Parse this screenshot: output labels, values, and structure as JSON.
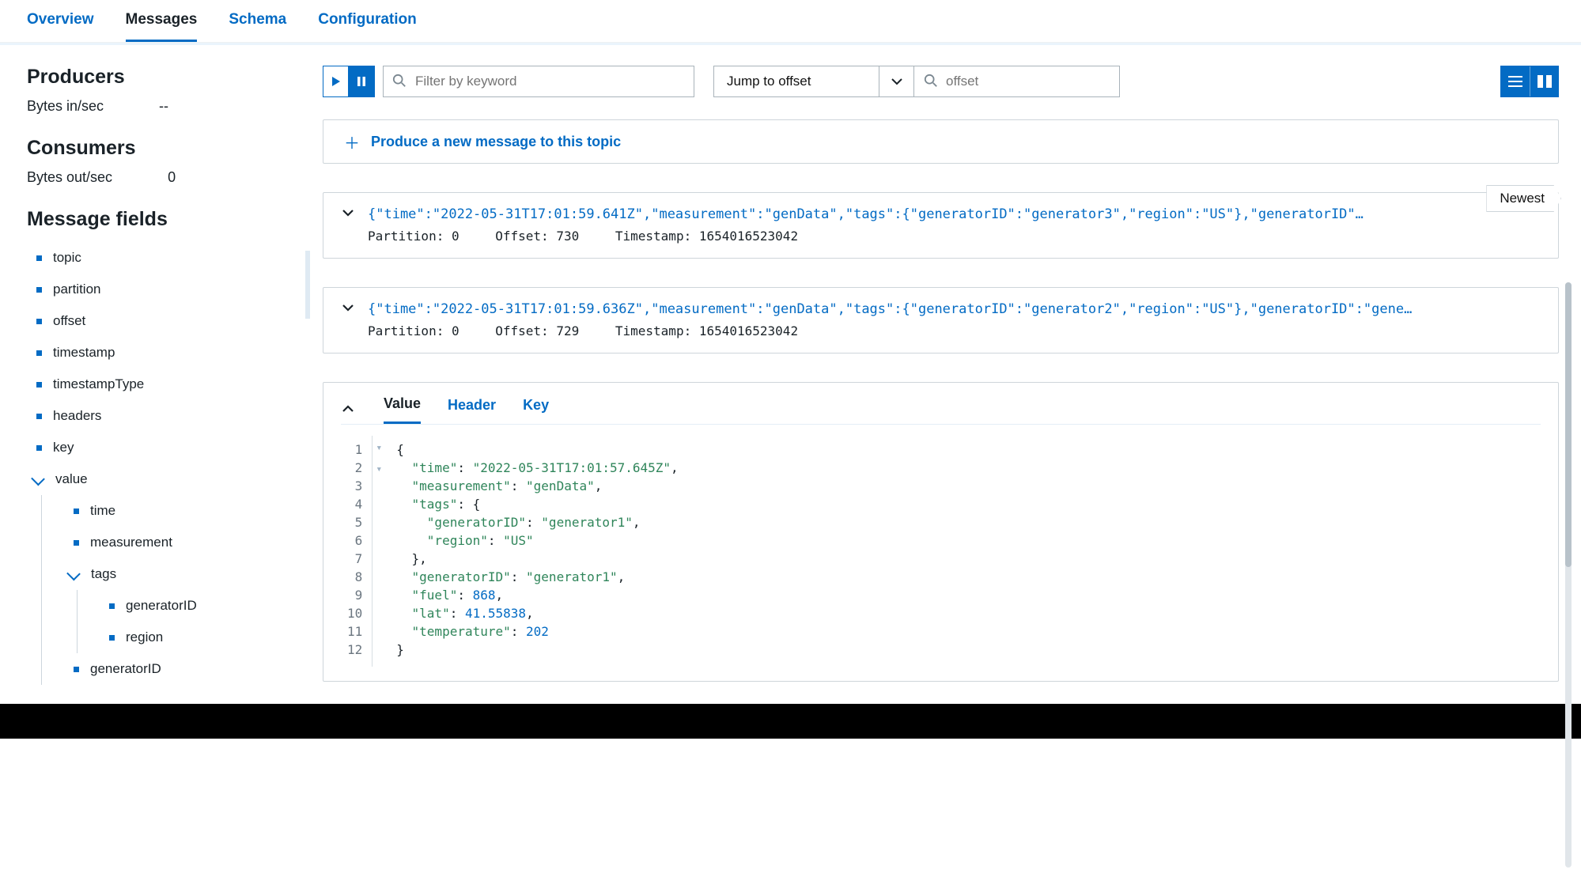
{
  "tabs": {
    "overview": "Overview",
    "messages": "Messages",
    "schema": "Schema",
    "configuration": "Configuration"
  },
  "sidebar": {
    "producers": {
      "title": "Producers",
      "metric_label": "Bytes in/sec",
      "metric_value": "--"
    },
    "consumers": {
      "title": "Consumers",
      "metric_label": "Bytes out/sec",
      "metric_value": "0"
    },
    "message_fields_title": "Message fields",
    "fields": [
      {
        "label": "topic"
      },
      {
        "label": "partition"
      },
      {
        "label": "offset"
      },
      {
        "label": "timestamp"
      },
      {
        "label": "timestampType"
      },
      {
        "label": "headers"
      },
      {
        "label": "key"
      }
    ],
    "value_label": "value",
    "value_children": [
      {
        "label": "time"
      },
      {
        "label": "measurement"
      }
    ],
    "tags_label": "tags",
    "tags_children": [
      {
        "label": "generatorID"
      },
      {
        "label": "region"
      }
    ],
    "trailing": {
      "label": "generatorID"
    }
  },
  "toolbar": {
    "filter_placeholder": "Filter by keyword",
    "jump_label": "Jump to offset",
    "offset_placeholder": "offset"
  },
  "produce_label": "Produce a new message to this topic",
  "newest_label": "Newest",
  "messages": [
    {
      "json_preview": "{\"time\":\"2022-05-31T17:01:59.641Z\",\"measurement\":\"genData\",\"tags\":{\"generatorID\":\"generator3\",\"region\":\"US\"},\"generatorID\"…",
      "partition": "0",
      "offset": "730",
      "timestamp": "1654016523042"
    },
    {
      "json_preview": "{\"time\":\"2022-05-31T17:01:59.636Z\",\"measurement\":\"genData\",\"tags\":{\"generatorID\":\"generator2\",\"region\":\"US\"},\"generatorID\":\"gene…",
      "partition": "0",
      "offset": "729",
      "timestamp": "1654016523042"
    }
  ],
  "inner_tabs": {
    "value": "Value",
    "header": "Header",
    "key": "Key"
  },
  "code": {
    "line_count": 12,
    "lines": {
      "l1": "{",
      "l2_k": "\"time\"",
      "l2_v": "\"2022-05-31T17:01:57.645Z\"",
      "l3_k": "\"measurement\"",
      "l3_v": "\"genData\"",
      "l4_k": "\"tags\"",
      "l5_k": "\"generatorID\"",
      "l5_v": "\"generator1\"",
      "l6_k": "\"region\"",
      "l6_v": "\"US\"",
      "l7": "},",
      "l8_k": "\"generatorID\"",
      "l8_v": "\"generator1\"",
      "l9_k": "\"fuel\"",
      "l9_v": "868",
      "l10_k": "\"lat\"",
      "l10_v": "41.55838",
      "l11_k": "\"temperature\"",
      "l11_v": "202",
      "l12": "}"
    }
  },
  "meta_labels": {
    "partition": "Partition:",
    "offset": "Offset:",
    "timestamp": "Timestamp:"
  }
}
